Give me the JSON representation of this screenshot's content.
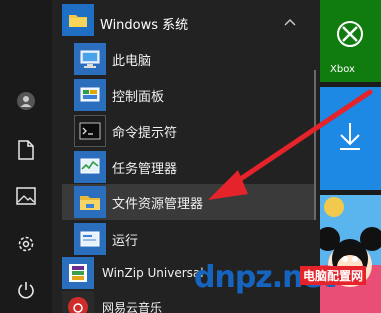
{
  "group": {
    "title": "Windows 系统",
    "collapse_icon": "chevron-up-icon"
  },
  "apps": [
    {
      "label": "此电脑",
      "icon": "computer-icon"
    },
    {
      "label": "控制面板",
      "icon": "control-panel-icon"
    },
    {
      "label": "命令提示符",
      "icon": "command-prompt-icon"
    },
    {
      "label": "任务管理器",
      "icon": "task-manager-icon"
    },
    {
      "label": "文件资源管理器",
      "icon": "folder-icon"
    },
    {
      "label": "运行",
      "icon": "run-icon"
    },
    {
      "label": "WinZip Universal",
      "icon": "winzip-icon"
    },
    {
      "label": "网易云音乐",
      "icon": "netease-music-icon"
    }
  ],
  "tiles": {
    "xbox": {
      "label": "Xbox"
    }
  },
  "rail": [
    "user-avatar-icon",
    "document-icon",
    "pictures-icon",
    "settings-icon",
    "power-icon"
  ],
  "watermark": {
    "brand": "dnpz.net",
    "site_name": "电脑配置网"
  },
  "colors": {
    "accent_blue": "#1e88e5",
    "tile_green": "#107c10",
    "arrow_red": "#e4232a",
    "highlight": "#3a3a3a"
  }
}
